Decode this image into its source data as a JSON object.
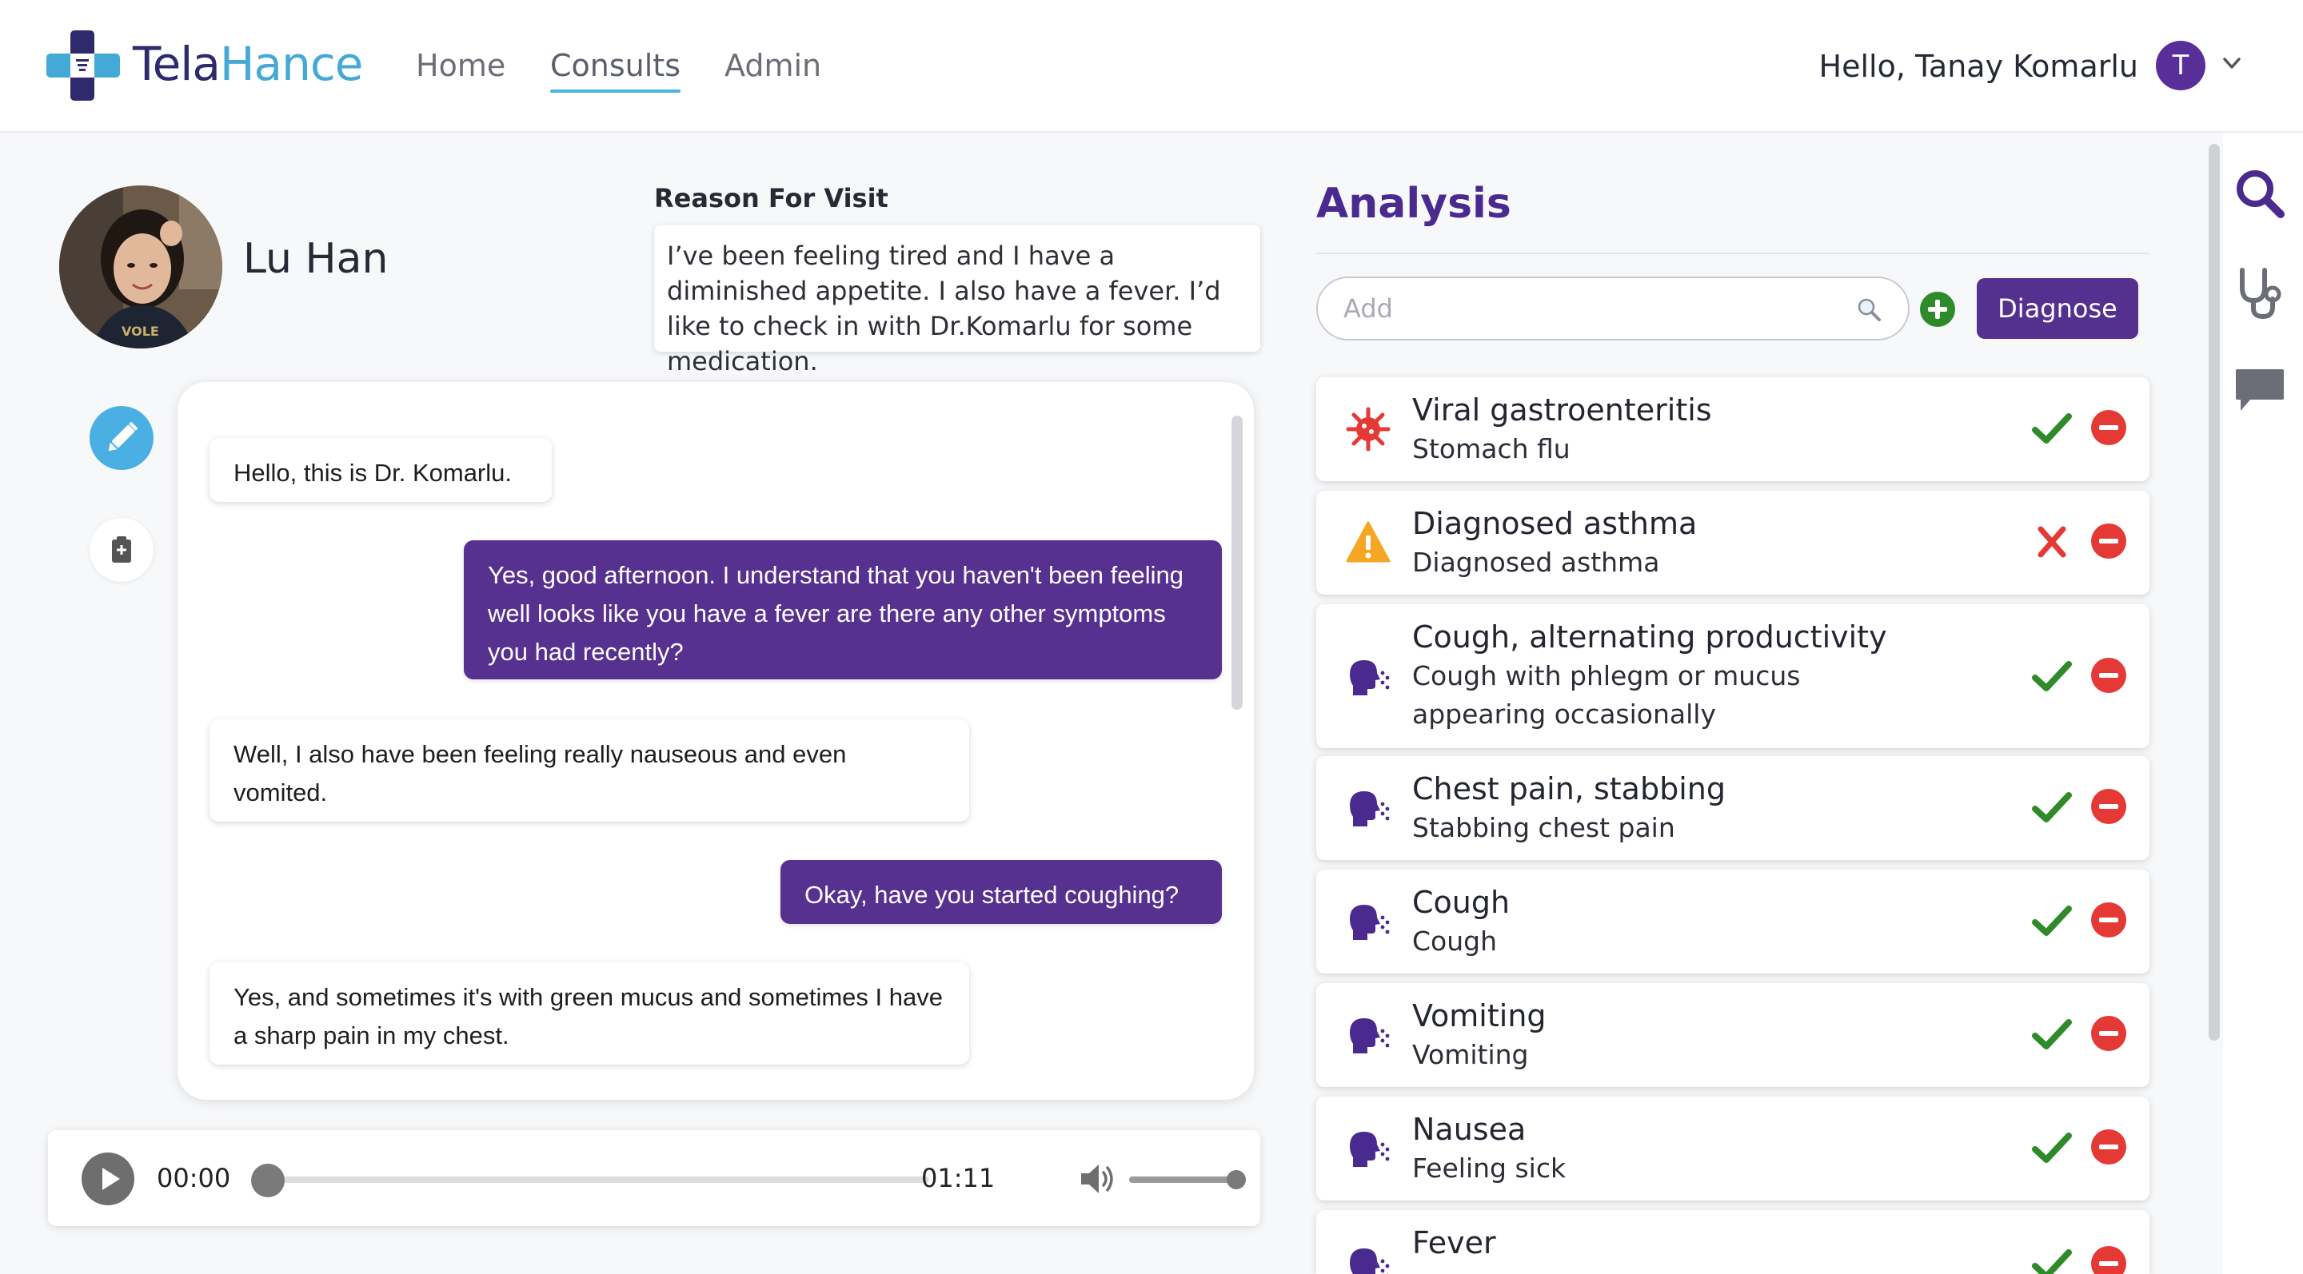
{
  "app": {
    "brand_part1": "Tela",
    "brand_part2": "Hance",
    "nav": {
      "home": "Home",
      "consults": "Consults",
      "admin": "Admin"
    },
    "greeting": "Hello, Tanay Komarlu",
    "user_initial": "T"
  },
  "patient": {
    "name": "Lu Han",
    "reason_title": "Reason For Visit",
    "reason_text": "I’ve been feeling tired and I have a diminished appetite. I also have a fever. I’d like to check in with Dr.Komarlu for some medication."
  },
  "chat": [
    {
      "from": "patient",
      "text": "Hello, this is Dr. Komarlu."
    },
    {
      "from": "doctor",
      "text": "Yes, good afternoon. I understand that you haven't been feeling well looks like you have a fever are there any other symptoms you had recently?"
    },
    {
      "from": "patient",
      "text": "Well, I also have been feeling really nauseous and even vomited."
    },
    {
      "from": "doctor",
      "text": "Okay, have you started coughing?"
    },
    {
      "from": "patient",
      "text": "Yes, and sometimes it's with green mucus and sometimes I have a sharp pain in my chest."
    }
  ],
  "player": {
    "current_time": "00:00",
    "total_time": "01:11",
    "progress": 0,
    "volume": 1.0
  },
  "analysis": {
    "title": "Analysis",
    "add_placeholder": "Add",
    "diagnose_label": "Diagnose",
    "items": [
      {
        "title": "Viral gastroenteritis",
        "subtitle": "Stomach flu",
        "icon": "virus-icon",
        "status": "confirmed"
      },
      {
        "title": "Diagnosed asthma",
        "subtitle": "Diagnosed asthma",
        "icon": "warning-icon",
        "status": "rejected"
      },
      {
        "title": "Cough, alternating productivity",
        "subtitle": "Cough with phlegm or mucus appearing occasionally",
        "icon": "cough-icon",
        "status": "confirmed"
      },
      {
        "title": "Chest pain, stabbing",
        "subtitle": "Stabbing chest pain",
        "icon": "cough-icon",
        "status": "confirmed"
      },
      {
        "title": "Cough",
        "subtitle": "Cough",
        "icon": "cough-icon",
        "status": "confirmed"
      },
      {
        "title": "Vomiting",
        "subtitle": "Vomiting",
        "icon": "cough-icon",
        "status": "confirmed"
      },
      {
        "title": "Nausea",
        "subtitle": "Feeling sick",
        "icon": "cough-icon",
        "status": "confirmed"
      },
      {
        "title": "Fever",
        "subtitle": "",
        "icon": "cough-icon",
        "status": "confirmed"
      }
    ]
  },
  "colors": {
    "brand_dark": "#2f2a6d",
    "brand_light": "#45a9d8",
    "accent_purple": "#54308f",
    "check_green": "#2f8a2a",
    "remove_red": "#e53935"
  },
  "rail_icons": [
    "search-icon",
    "stethoscope-icon",
    "chat-icon"
  ]
}
